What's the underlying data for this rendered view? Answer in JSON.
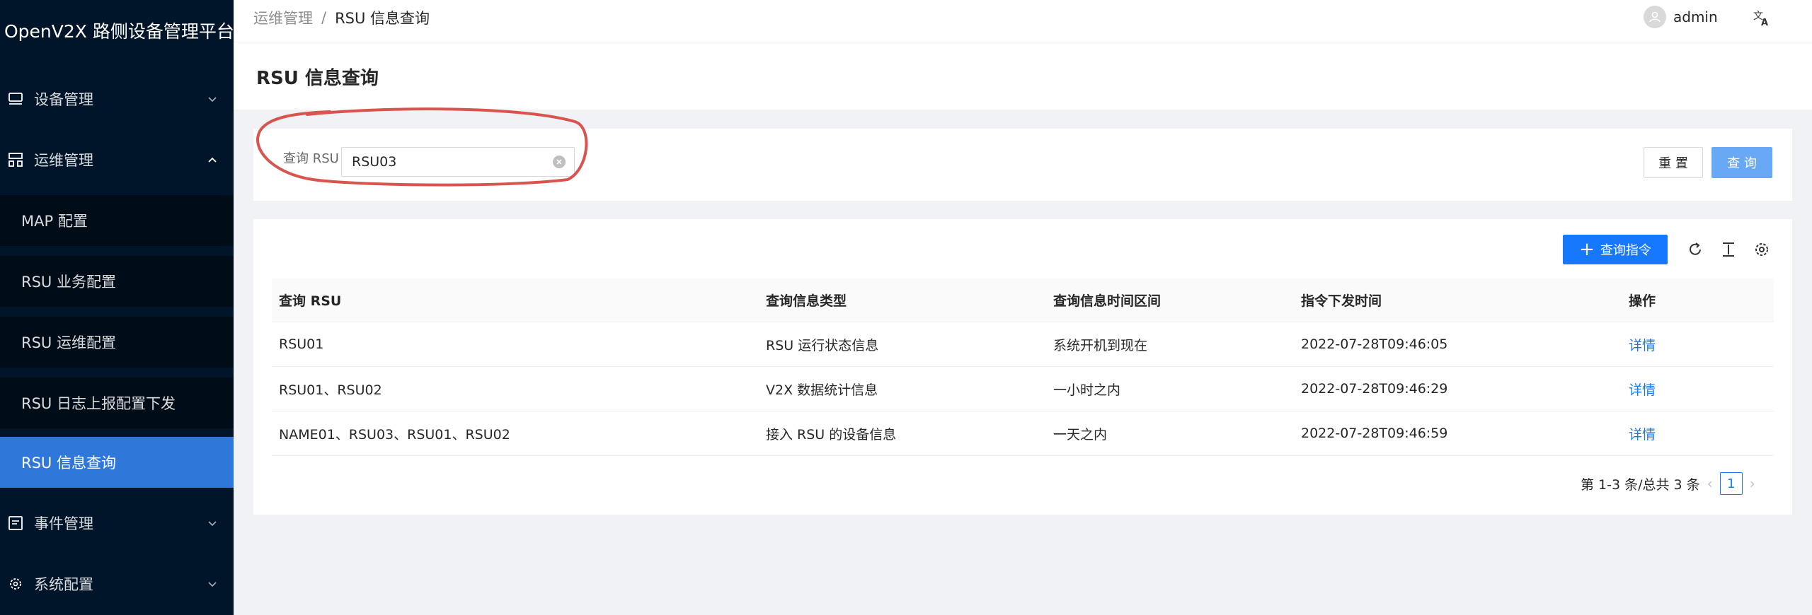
{
  "app": {
    "title": "OpenV2X 路侧设备管理平台"
  },
  "sidebar": {
    "menus": [
      {
        "label": "设备管理",
        "icon": "device-icon",
        "expanded": false
      },
      {
        "label": "运维管理",
        "icon": "ops-icon",
        "expanded": true
      },
      {
        "label": "事件管理",
        "icon": "event-icon",
        "expanded": false
      },
      {
        "label": "系统配置",
        "icon": "settings-icon",
        "expanded": false
      }
    ],
    "submenu": [
      {
        "label": "MAP 配置"
      },
      {
        "label": "RSU 业务配置"
      },
      {
        "label": "RSU 运维配置"
      },
      {
        "label": "RSU 日志上报配置下发"
      },
      {
        "label": "RSU 信息查询",
        "active": true
      }
    ]
  },
  "header": {
    "breadcrumb": [
      "运维管理",
      "RSU 信息查询"
    ],
    "breadcrumb_sep": "/",
    "user": "admin"
  },
  "page": {
    "title": "RSU 信息查询"
  },
  "search": {
    "label": "查询 RSU",
    "value": "RSU03",
    "reset_label": "重 置",
    "query_label": "查 询"
  },
  "table": {
    "add_label": "查询指令",
    "columns": [
      "查询 RSU",
      "查询信息类型",
      "查询信息时间区间",
      "指令下发时间",
      "操作"
    ],
    "rows": [
      [
        "RSU01",
        "RSU 运行状态信息",
        "系统开机到现在",
        "2022-07-28T09:46:05",
        "详情"
      ],
      [
        "RSU01、RSU02",
        "V2X 数据统计信息",
        "一小时之内",
        "2022-07-28T09:46:29",
        "详情"
      ],
      [
        "NAME01、RSU03、RSU01、RSU02",
        "接入 RSU 的设备信息",
        "一天之内",
        "2022-07-28T09:46:59",
        "详情"
      ]
    ]
  },
  "pagination": {
    "summary": "第 1-3 条/总共 3 条",
    "current": "1",
    "prev": "‹",
    "next": "›"
  },
  "colors": {
    "sidebar_bg": "#001529",
    "active": "#2f77d8",
    "primary": "#1677ff",
    "annotation": "#d9534f"
  }
}
